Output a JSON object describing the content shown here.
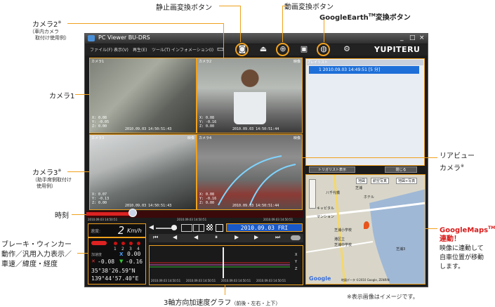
{
  "annotations": {
    "camera2": "カメラ2",
    "camera2_sup": "※",
    "camera2_note1": "（車内カメラ",
    "camera2_note2": "取付け使用例）",
    "still_btn": "静止画変換ボタン",
    "video_btn": "動画変換ボタン",
    "ge_btn_pre": "GoogleEarth",
    "ge_btn_tm": "TM",
    "ge_btn_post": "変換ボタン",
    "camera1": "カメラ1",
    "camera3": "カメラ3",
    "camera3_sup": "※",
    "camera3_note1": "（助手席側取付け",
    "camera3_note2": "使用例）",
    "time": "時刻",
    "brake1": "ブレーキ・ウィンカー",
    "brake2": "動作／汎用入力表示／",
    "brake3": "車速／緯度・経度",
    "rear1": "リアビュー",
    "rear2": "カメラ",
    "rear_sup": "※",
    "gmaps_pre": "GoogleMaps",
    "gmaps_tm": "TM",
    "gmaps_post": "連動！",
    "gmaps_d1": "映像に連動して",
    "gmaps_d2": "自車位置が移動",
    "gmaps_d3": "します。",
    "accel_main": "3軸方向加速度グラフ",
    "accel_sub": "（前後・左右・上下）",
    "note": "※表示画像はイメージです。"
  },
  "window": {
    "title": "PC Viewer BU-DRS",
    "minimize": "_",
    "maximize": "□",
    "close": "×",
    "menus": [
      "ファイル(F)",
      "表示(V)",
      "再生(E)",
      "ツール(T)",
      "インフォメーション(I)"
    ],
    "brand": "YUPITERU"
  },
  "cameras": [
    {
      "label": "カメラ1",
      "tag": "",
      "x": "X: 0.08",
      "y": "Y: -0.05",
      "z": "Z: 0.00",
      "ts": "2010.09.03 14:50:51:43"
    },
    {
      "label": "カメラ2",
      "tag": "映像",
      "x": "X: 0.08",
      "y": "Y: -0.16",
      "z": "Z: 0.00",
      "ts": "2010.09.03 14:50:51:44"
    },
    {
      "label": "カメラ3",
      "tag": "映像",
      "x": "X: 0.07",
      "y": "Y: -0.13",
      "z": "Z: 0.00",
      "ts": "2010.09.03 14:50:51:43"
    },
    {
      "label": "カメラ4",
      "tag": "映像",
      "x": "X: 0.08",
      "y": "Y: -0.16",
      "z": "Z: 0.00",
      "ts": "2010.09.03 14:50:51:44"
    }
  ],
  "playlist": {
    "header": "プレイリスト",
    "item": "1  2010.09.03 14:49:51 [5 分]",
    "trigger_btn": "トリガリスト表示",
    "close_btn": "閉じる"
  },
  "map": {
    "tabs": [
      "地図",
      "航空写真",
      "地図+写真"
    ],
    "labels": [
      "芝浦",
      "ホテル",
      "キャピタル",
      "八千代橋",
      "芝浦小学校",
      "マンション",
      "芝浦",
      "芝浦3",
      "芝浦",
      "港区立",
      "芝浦中学校"
    ],
    "copyright": "地図データ ©2010 Google, ZENRIN",
    "google": "Google"
  },
  "controls": {
    "time": "2010.09.03 FRI 14:50:51",
    "speed_label": "速度:",
    "speed": "2",
    "speed_unit": "Km/h",
    "input_nums": [
      "1",
      "2",
      "3",
      "4"
    ],
    "accel_label": "加速度",
    "ax_label": "X",
    "ax": "0.00",
    "ay": "-0.08",
    "az": "-0.16",
    "lat": "35°38'26.59\"N",
    "lon": "139°44'57.40\"E",
    "graph_ticks": [
      "2010.09.03 14:50:51",
      "2010.09.03 14:50:51",
      "2010.09.03 14:50:51",
      "2010.09.03 14:50:51"
    ],
    "graph_axis": [
      "X",
      "Y",
      "Z"
    ],
    "seek_progress": 0.21,
    "seek_ts_left": "2010.09.03 14:50:51",
    "seek_ts_mid": "2010.09.03 14:50:51",
    "seek_ts_right": "2010.09.03 14:50:51"
  },
  "colors": {
    "accent": "#f0a11e",
    "lcd_blue": "#1858c8",
    "gmaps_red": "#d91a1a"
  }
}
